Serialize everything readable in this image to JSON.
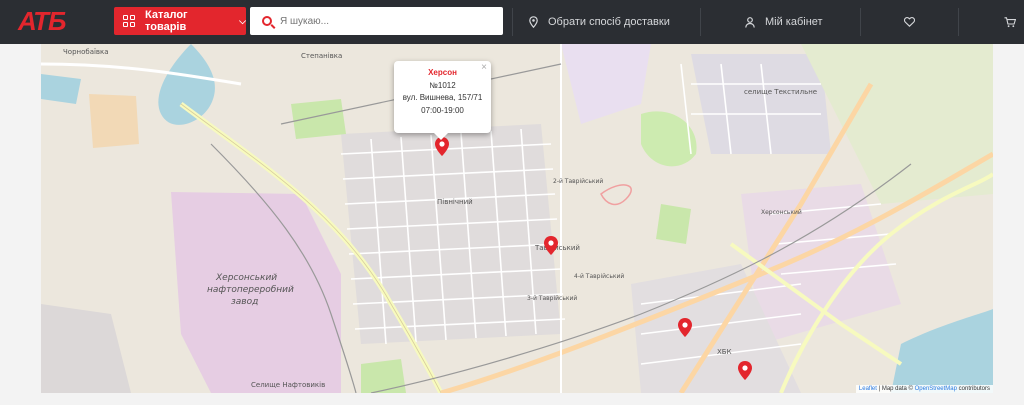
{
  "header": {
    "logo": "АТБ",
    "catalog_label": "Каталог товарів",
    "search_placeholder": "Я шукаю...",
    "delivery_label": "Обрати спосіб доставки",
    "account_label": "Мій кабінет"
  },
  "map": {
    "popup": {
      "city": "Херсон",
      "store_number": "№1012",
      "address": "вул. Вишнева, 157/71",
      "hours": "07:00-19:00",
      "close_glyph": "×"
    },
    "labels": {
      "chornobaivka": "Чорнобаївка",
      "stepanivka": "Степанівка",
      "selyshche_tekstylne": "селище Текстильне",
      "pivnichnyi": "Північний",
      "tavriiskyi_2": "2-й Таврійський",
      "tavriiskyi": "Таврійський",
      "tavriiskyi_4": "4-й Таврійський",
      "tavriiskyi_3": "3-й Таврійський",
      "refinery_1": "Херсонський",
      "refinery_2": "нафтопереробний",
      "refinery_3": "завод",
      "khersonskyi": "Херсонський",
      "selyshche_naftovykiv": "Селище Нафтовиків",
      "khbk": "ХБК"
    },
    "attribution": {
      "leaflet": "Leaflet",
      "sep1": "|",
      "map_data": "Map data ©",
      "osm": "OpenStreetMap",
      "contributors": "contributors"
    }
  },
  "colors": {
    "brand_red": "#e3262d",
    "header_bg": "#2b2e33"
  }
}
